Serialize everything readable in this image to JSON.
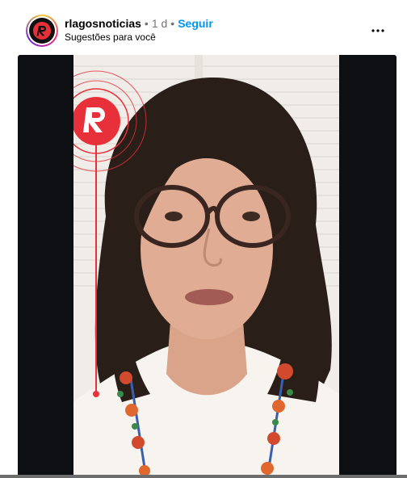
{
  "post": {
    "username": "rlagosnoticias",
    "separator": "•",
    "time": "1 d",
    "follow_label": "Seguir",
    "subtitle": "Sugestões para você"
  },
  "icons": {
    "more": "more-options-icon",
    "avatar_logo": "r-logo-icon",
    "overlay_logo": "r-logo-icon"
  },
  "colors": {
    "follow_blue": "#0095f6",
    "brand_red": "#e8303a",
    "media_background": "#0d0f13"
  }
}
